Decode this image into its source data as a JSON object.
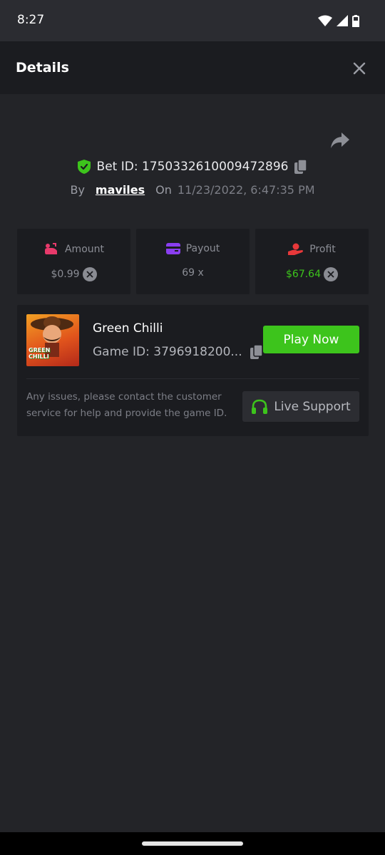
{
  "status_bar": {
    "time": "8:27"
  },
  "header": {
    "title": "Details"
  },
  "bet": {
    "id_label": "Bet ID: 1750332610009472896",
    "by_label": "By",
    "username": "maviles",
    "on_label": "On",
    "date": "11/23/2022, 6:47:35 PM"
  },
  "stats": {
    "amount": {
      "label": "Amount",
      "value": "$0.99"
    },
    "payout": {
      "label": "Payout",
      "value": "69 x"
    },
    "profit": {
      "label": "Profit",
      "value": "$67.64"
    }
  },
  "game": {
    "name": "Green Chilli",
    "id_label": "Game ID: 3796918200...",
    "thumb_text": "GREEN CHILLI",
    "play_label": "Play Now",
    "help_text": "Any issues, please contact the customer service for help and provide the game ID.",
    "support_label": "Live Support"
  },
  "colors": {
    "accent_green": "#3dc41c",
    "amount_icon": "#e83a6b",
    "payout_icon": "#8a3ef0",
    "profit_icon": "#e8383a"
  }
}
